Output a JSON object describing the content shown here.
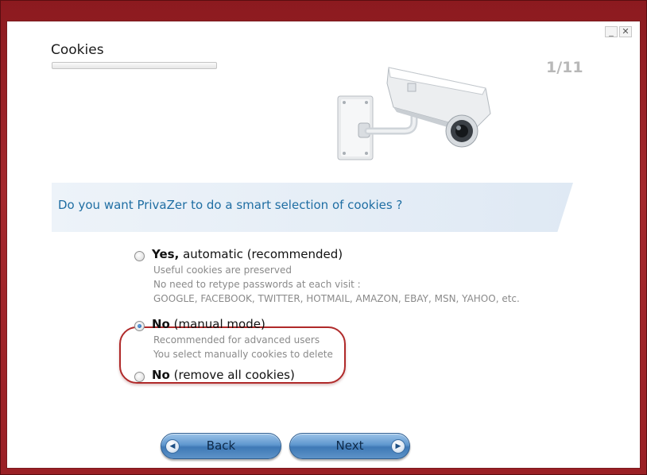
{
  "window": {
    "minimize_glyph": "_",
    "close_glyph": "✕"
  },
  "header": {
    "title": "Cookies",
    "step": "1/11",
    "progress": 0.0
  },
  "question": "Do you want PrivaZer to do a smart selection of cookies ?",
  "options": [
    {
      "bold": "Yes,",
      "rest": " automatic (recommended)",
      "selected": false,
      "desc": [
        "Useful cookies are preserved",
        "No need to retype passwords at each visit :",
        "GOOGLE, FACEBOOK, TWITTER, HOTMAIL, AMAZON, EBAY, MSN, YAHOO, etc."
      ]
    },
    {
      "bold": "No",
      "rest": " (manual mode)",
      "selected": true,
      "desc": [
        "Recommended for advanced users",
        "You select manually cookies to delete"
      ]
    },
    {
      "bold": "No",
      "rest": " (remove all cookies)",
      "selected": false,
      "desc": []
    }
  ],
  "buttons": {
    "back": "Back",
    "next": "Next"
  },
  "icons": {
    "camera": "security-camera-icon",
    "back_arrow": "left-arrow-icon",
    "next_arrow": "right-arrow-icon"
  },
  "colors": {
    "accent": "#1f6ea3",
    "highlight": "#b02a2a",
    "button": "#4f86bf"
  }
}
